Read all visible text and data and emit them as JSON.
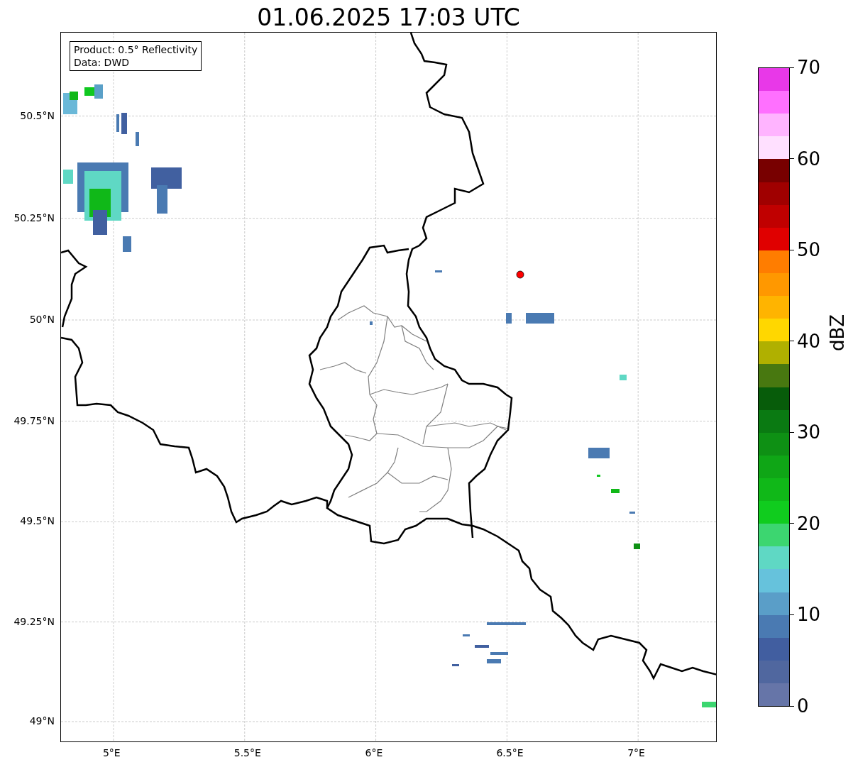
{
  "title": "01.06.2025 17:03 UTC",
  "legend": [
    "Product: 0.5° Reflectivity",
    "Data: DWD"
  ],
  "lat_labels": [
    "50.5°N",
    "50.25°N",
    "50°N",
    "49.75°N",
    "49.5°N",
    "49.25°N",
    "49°N"
  ],
  "lon_labels": [
    "5°E",
    "5.5°E",
    "6°E",
    "6.5°E",
    "7°E"
  ],
  "colorbar": {
    "label": "dBZ",
    "ticks": [
      "70",
      "60",
      "50",
      "40",
      "30",
      "20",
      "10",
      "0"
    ],
    "bins": [
      {
        "color": "#e838e8"
      },
      {
        "color": "#ff70ff"
      },
      {
        "color": "#ffb4ff"
      },
      {
        "color": "#ffe0ff"
      },
      {
        "color": "#780000"
      },
      {
        "color": "#a00000"
      },
      {
        "color": "#c00000"
      },
      {
        "color": "#e00000"
      },
      {
        "color": "#ff7d00"
      },
      {
        "color": "#ff9800"
      },
      {
        "color": "#ffb400"
      },
      {
        "color": "#ffd700"
      },
      {
        "color": "#b0b000"
      },
      {
        "color": "#487810"
      },
      {
        "color": "#075c0a"
      },
      {
        "color": "#0a7a12"
      },
      {
        "color": "#0e9014"
      },
      {
        "color": "#0fa616"
      },
      {
        "color": "#10b818"
      },
      {
        "color": "#10cc1e"
      },
      {
        "color": "#3cd670"
      },
      {
        "color": "#5fd8c4"
      },
      {
        "color": "#66c2dc"
      },
      {
        "color": "#5a9ec8"
      },
      {
        "color": "#4a7ab2"
      },
      {
        "color": "#415ea0"
      },
      {
        "color": "#50679f"
      },
      {
        "color": "#6675a8"
      }
    ]
  }
}
